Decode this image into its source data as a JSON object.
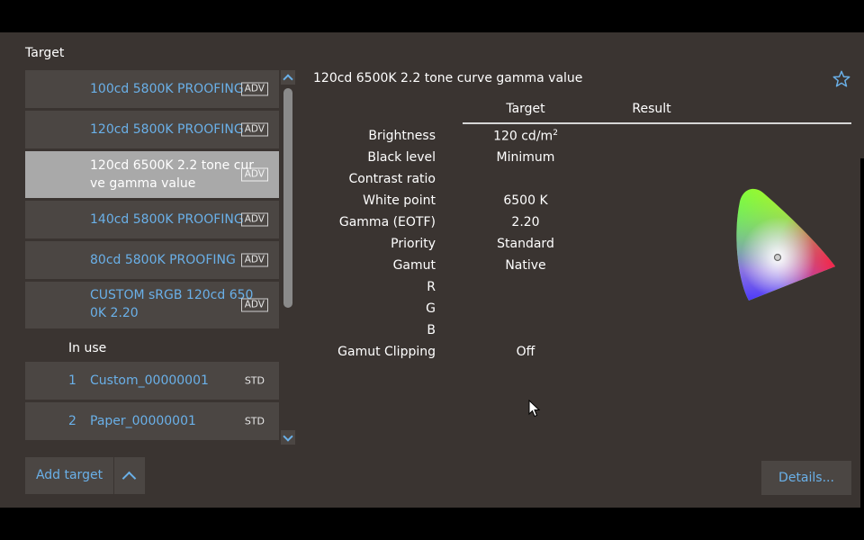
{
  "target_section": {
    "title": "Target",
    "items": [
      {
        "line1": "100cd 5800K PROOFING",
        "line2": "",
        "badge": "ADV",
        "selected": false
      },
      {
        "line1": "120cd 5800K PROOFING",
        "line2": "",
        "badge": "ADV",
        "selected": false
      },
      {
        "line1": "120cd 6500K 2.2 tone cur",
        "line2": "ve gamma value",
        "badge": "ADV",
        "selected": true
      },
      {
        "line1": "140cd 5800K PROOFING",
        "line2": "",
        "badge": "ADV",
        "selected": false
      },
      {
        "line1": "80cd 5800K PROOFING",
        "line2": "",
        "badge": "ADV",
        "selected": false
      },
      {
        "line1": "CUSTOM sRGB 120cd 650",
        "line2": "0K 2.20",
        "badge": "ADV",
        "selected": false
      }
    ],
    "in_use_label": "In use",
    "in_use_items": [
      {
        "num": "1",
        "name": "Custom_00000001",
        "badge": "STD"
      },
      {
        "num": "2",
        "name": "Paper_00000001",
        "badge": "STD"
      }
    ],
    "add_target_label": "Add target"
  },
  "detail": {
    "title": "120cd 6500K 2.2 tone curve gamma value",
    "col_target": "Target",
    "col_result": "Result",
    "rows": [
      {
        "label": "Brightness",
        "target": "120 cd/m",
        "sup": "2"
      },
      {
        "label": "Black level",
        "target": "Minimum"
      },
      {
        "label": "Contrast ratio",
        "target": ""
      },
      {
        "label": "White point",
        "target": "6500 K"
      },
      {
        "label": "Gamma (EOTF)",
        "target": "2.20"
      },
      {
        "label": "Priority",
        "target": "Standard"
      },
      {
        "label": "Gamut",
        "target": "Native"
      },
      {
        "label": "R",
        "target": ""
      },
      {
        "label": "G",
        "target": ""
      },
      {
        "label": "B",
        "target": ""
      },
      {
        "label": "Gamut Clipping",
        "target": "Off"
      }
    ],
    "details_button": "Details..."
  },
  "colors": {
    "panel_bg": "#3a3431",
    "item_bg": "#4b4643",
    "selected_bg": "#a9a9a9",
    "link": "#6ab0e8"
  }
}
